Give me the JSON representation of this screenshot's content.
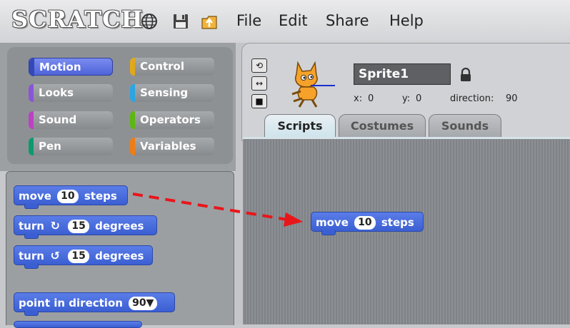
{
  "app": {
    "logo": "SCRATCH"
  },
  "toolbar": {
    "icons": [
      "globe-icon",
      "save-icon",
      "upload-icon"
    ]
  },
  "menu": {
    "file": "File",
    "edit": "Edit",
    "share": "Share",
    "help": "Help"
  },
  "categories": [
    {
      "label": "Motion",
      "color": "#4a6cd4",
      "selected": true
    },
    {
      "label": "Control",
      "color": "#e1a91a"
    },
    {
      "label": "Looks",
      "color": "#8a55d7"
    },
    {
      "label": "Sensing",
      "color": "#2ca5e2"
    },
    {
      "label": "Sound",
      "color": "#bb42c3"
    },
    {
      "label": "Operators",
      "color": "#5cb712"
    },
    {
      "label": "Pen",
      "color": "#0e9a6c"
    },
    {
      "label": "Variables",
      "color": "#ee7d16"
    }
  ],
  "palette_blocks": {
    "move": {
      "pre": "move",
      "value": "10",
      "post": "steps"
    },
    "turn_right": {
      "pre": "turn",
      "glyph": "↻",
      "value": "15",
      "post": "degrees"
    },
    "turn_left": {
      "pre": "turn",
      "glyph": "↺",
      "value": "15",
      "post": "degrees"
    },
    "point": {
      "pre": "point in direction",
      "value": "90▼"
    }
  },
  "sprite": {
    "name": "Sprite1",
    "x_label": "x:",
    "x": "0",
    "y_label": "y:",
    "y": "0",
    "dir_label": "direction:",
    "direction": "90"
  },
  "tabs": {
    "scripts": "Scripts",
    "costumes": "Costumes",
    "sounds": "Sounds"
  },
  "script_blocks": {
    "move": {
      "pre": "move",
      "value": "10",
      "post": "steps"
    }
  },
  "annotation": {
    "arrow_color": "#e8161b"
  }
}
